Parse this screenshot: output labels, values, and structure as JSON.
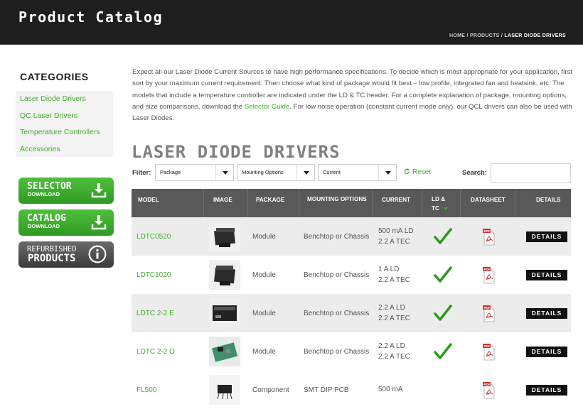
{
  "header": {
    "site_title": "Product Catalog",
    "breadcrumb": {
      "home": "HOME",
      "sep1": " / ",
      "products": "PRODUCTS",
      "sep2": " / ",
      "current": "LASER DIODE DRIVERS"
    }
  },
  "sidebar": {
    "title": "CATEGORIES",
    "items": [
      "Laser Diode Drivers",
      "QC Laser Drivers",
      "Temperature Controllers",
      "Accessories"
    ],
    "buttons": [
      {
        "line1": "SELECTOR",
        "line2": "DOWNLOAD",
        "icon": "download-icon"
      },
      {
        "line1": "CATALOG",
        "line2": "DOWNLOAD",
        "icon": "download-icon"
      },
      {
        "line1": "REFURBISHED",
        "line2": "PRODUCTS",
        "icon": "info-icon"
      }
    ]
  },
  "intro": {
    "text_before": "Expect all our Laser Diode Current Sources to have high performance specifications. To decide which is most appropriate for your application, first sort by your maximum current requirement. Then choose what kind of package would fit best – low profile, integrated fan and heatsink, etc. The models that include a temperature controller are indicated under the LD & TC header. For a complete explanation of package, mounting options, and size comparisons, download the ",
    "link": "Selector Guide",
    "text_after": ". For low noise operation (constant current mode only), our QCL drivers can also be used with Laser Diodes."
  },
  "page_heading": "LASER DIODE DRIVERS",
  "filters": {
    "label": "Filter:",
    "package": "Package",
    "mounting": "Mounting Options",
    "current": "Current",
    "reset": "Reset",
    "search_label": "Search:",
    "search_value": ""
  },
  "table": {
    "headers": {
      "model": "MODEL",
      "image": "IMAGE",
      "package": "PACKAGE",
      "mounting": "MOUNTING OPTIONS",
      "current": "CURRENT",
      "ldtc": "LD & TC",
      "datasheet": "DATASHEET",
      "details": "DETAILS"
    },
    "rows": [
      {
        "model": "LDTC0520",
        "package": "Module",
        "mounting": "Benchtop or Chassis",
        "current_1": "500 mA LD",
        "current_2": "2.2 A TEC",
        "ldtc": true,
        "details": "DETAILS"
      },
      {
        "model": "LDTC1020",
        "package": "Module",
        "mounting": "Benchtop or Chassis",
        "current_1": "1 A LD",
        "current_2": "2.2 A TEC",
        "ldtc": true,
        "details": "DETAILS"
      },
      {
        "model": "LDTC 2-2 E",
        "package": "Module",
        "mounting": "Benchtop or Chassis",
        "current_1": "2.2 A LD",
        "current_2": "2.2 A TEC",
        "ldtc": true,
        "details": "DETAILS"
      },
      {
        "model": "LDTC 2-2 O",
        "package": "Module",
        "mounting": "Benchtop or Chassis",
        "current_1": "2.2 A LD",
        "current_2": "2.2 A TEC",
        "ldtc": true,
        "details": "DETAILS"
      },
      {
        "model": "FL500",
        "package": "Component",
        "mounting": "SMT DIP PCB",
        "current_1": "500 mA",
        "current_2": "",
        "ldtc": false,
        "details": "DETAILS"
      }
    ]
  },
  "colors": {
    "accent": "#3fae2a",
    "header_bg": "#1e1e1e",
    "table_head": "#595959",
    "row_alt": "#ececec"
  }
}
